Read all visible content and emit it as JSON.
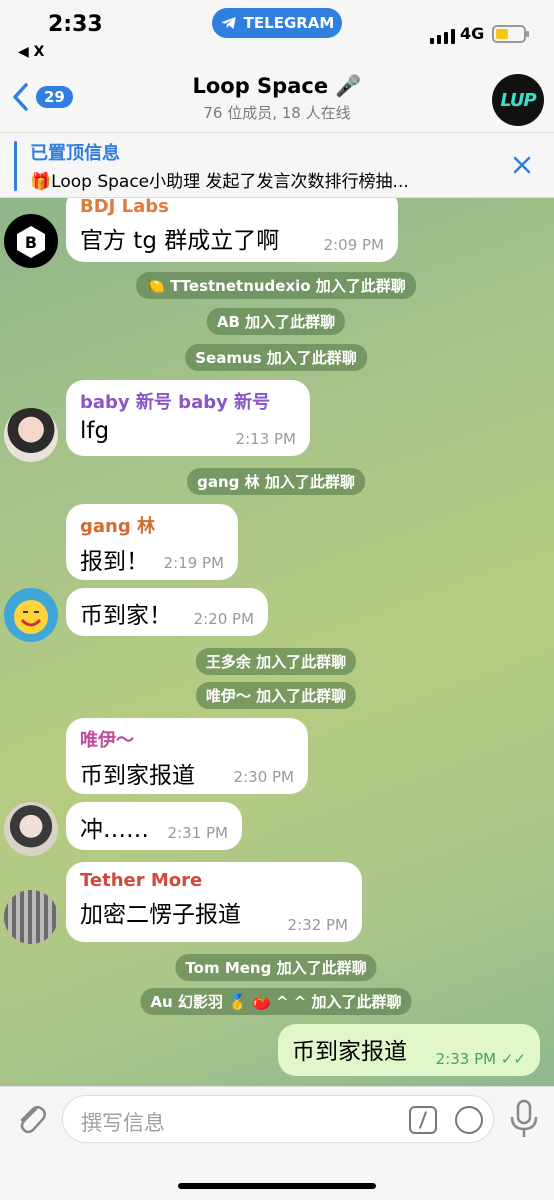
{
  "status_bar": {
    "time": "2:33",
    "pill_label": "TELEGRAM",
    "back_app": "◀ X",
    "network": "4G",
    "battery_level": 0.45
  },
  "header": {
    "back_count": "29",
    "title": "Loop Space 🎤",
    "subtitle": "76 位成员, 18 人在线",
    "group_avatar_text": "LUP"
  },
  "pinned": {
    "label": "已置顶信息",
    "text": "🎁Loop Space小助理 发起了发言次数排行榜抽..."
  },
  "messages": [
    {
      "sender": "BDJ Labs",
      "text": "官方 tg 群成立了啊",
      "time": "2:09 PM",
      "sender_color": "#e0793c"
    },
    {
      "system": "🍋 TTestnetnudexio 加入了此群聊"
    },
    {
      "system": "AB 加入了此群聊"
    },
    {
      "system": "Seamus 加入了此群聊"
    },
    {
      "sender": "baby 新号 baby 新号",
      "text": "lfg",
      "time": "2:13 PM",
      "sender_color": "#8a55c9"
    },
    {
      "system": "gang 林 加入了此群聊"
    },
    {
      "sender": "gang 林",
      "text": "报到！",
      "time": "2:19 PM",
      "sender_color": "#d46a30"
    },
    {
      "text": "币到家！",
      "time": "2:20 PM"
    },
    {
      "system": "王多余 加入了此群聊"
    },
    {
      "system": "唯伊～ 加入了此群聊"
    },
    {
      "sender": "唯伊～",
      "text": "币到家报道",
      "time": "2:30 PM",
      "sender_color": "#c04a9b"
    },
    {
      "text": "冲……",
      "time": "2:31 PM"
    },
    {
      "sender": "Tether More",
      "text": "加密二愣子报道",
      "time": "2:32 PM",
      "sender_color": "#d0493c"
    },
    {
      "system": "Tom Meng 加入了此群聊"
    },
    {
      "system": "Au 幻影羽 🥇 🍅 ^ ^ 加入了此群聊"
    },
    {
      "text": "币到家报道",
      "time": "2:33 PM",
      "outgoing": true
    }
  ],
  "input": {
    "placeholder": "撰写信息"
  },
  "colors": {
    "accent": "#2f7fe0",
    "outgoing_bubble": "#e1f7c9",
    "chat_bg": "#a8c48a"
  }
}
